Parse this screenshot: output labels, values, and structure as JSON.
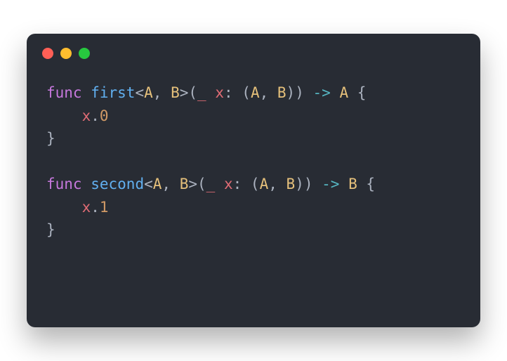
{
  "code": {
    "l1": {
      "kw": "func",
      "sp1": " ",
      "fn": "first",
      "lt": "<",
      "tA": "A",
      "comma": ", ",
      "tB": "B",
      "gt": ">",
      "lp": "(",
      "under": "_",
      "sp2": " ",
      "x": "x",
      "colon": ": (",
      "tA2": "A",
      "comma2": ", ",
      "tB2": "B",
      "rp": "))",
      "sp3": " ",
      "arrow": "->",
      "sp4": " ",
      "ret": "A",
      "sp5": " ",
      "brace": "{"
    },
    "l2": {
      "indent": "    ",
      "x": "x",
      "dot": ".",
      "num": "0"
    },
    "l3": {
      "brace": "}"
    },
    "l4": {
      "blank": ""
    },
    "l5": {
      "kw": "func",
      "sp1": " ",
      "fn": "second",
      "lt": "<",
      "tA": "A",
      "comma": ", ",
      "tB": "B",
      "gt": ">",
      "lp": "(",
      "under": "_",
      "sp2": " ",
      "x": "x",
      "colon": ": (",
      "tA2": "A",
      "comma2": ", ",
      "tB2": "B",
      "rp": "))",
      "sp3": " ",
      "arrow": "->",
      "sp4": " ",
      "ret": "B",
      "sp5": " ",
      "brace": "{"
    },
    "l6": {
      "indent": "    ",
      "x": "x",
      "dot": ".",
      "num": "1"
    },
    "l7": {
      "brace": "}"
    }
  }
}
